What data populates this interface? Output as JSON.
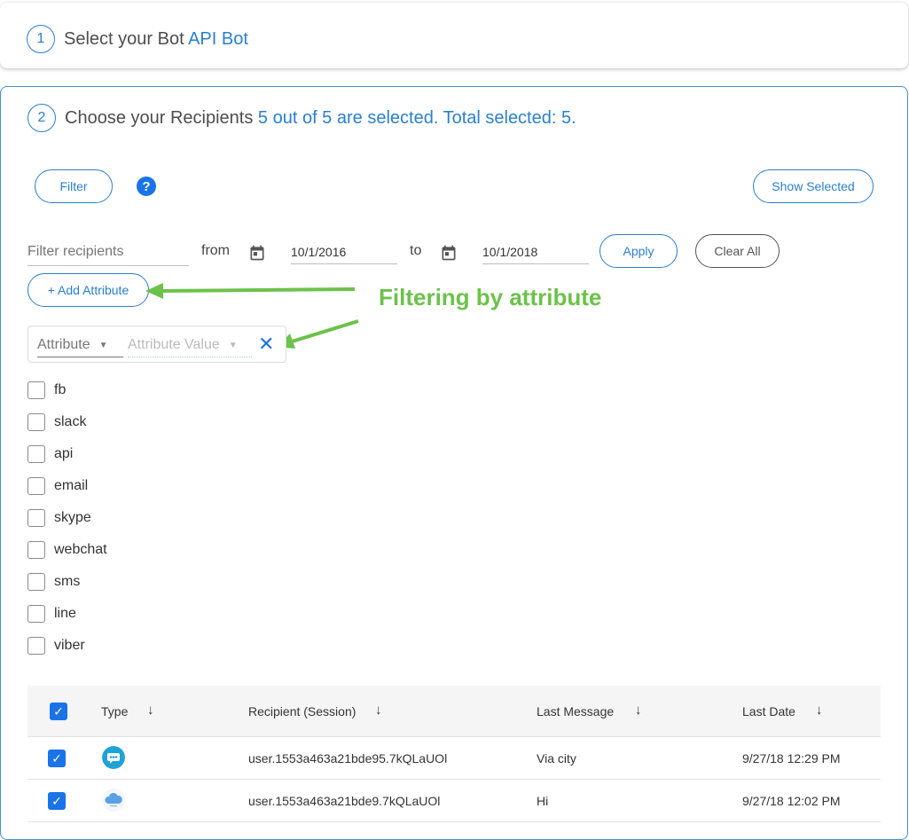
{
  "step1": {
    "number": "1",
    "title": "Select your Bot",
    "bot_name": "API Bot"
  },
  "step2": {
    "number": "2",
    "title": "Choose your Recipients",
    "selection_summary": "5 out of 5 are selected. Total selected: 5."
  },
  "toolbar": {
    "filter_label": "Filter",
    "help_symbol": "?",
    "show_selected_label": "Show Selected"
  },
  "filters": {
    "search_placeholder": "Filter recipients",
    "from_label": "from",
    "from_date": "10/1/2016",
    "to_label": "to",
    "to_date": "10/1/2018",
    "apply_label": "Apply",
    "clear_all_label": "Clear All",
    "add_attribute_label": "+ Add Attribute",
    "attribute_placeholder": "Attribute",
    "attribute_value_placeholder": "Attribute Value"
  },
  "annotation": {
    "text": "Filtering by attribute",
    "color": "#6cc24a"
  },
  "channels": [
    "fb",
    "slack",
    "api",
    "email",
    "skype",
    "webchat",
    "sms",
    "line",
    "viber"
  ],
  "table": {
    "headers": {
      "type": "Type",
      "recipient": "Recipient (Session)",
      "last_message": "Last Message",
      "last_date": "Last Date"
    },
    "sort_icon": "arrow-down-icon",
    "rows": [
      {
        "type_icon": "webchat-icon",
        "recipient": "user.1553a463a21bde95.7kQLaUOl",
        "last_message": "Via city",
        "last_date": "9/27/18 12:29 PM",
        "checked": true
      },
      {
        "type_icon": "cloud-api-icon",
        "recipient": "user.1553a463a21bde9.7kQLaUOl",
        "last_message": "Hi",
        "last_date": "9/27/18 12:02 PM",
        "checked": true
      }
    ]
  },
  "colors": {
    "accent": "#2a7fcf",
    "checkbox": "#1a73e8",
    "annotation": "#6cc24a"
  }
}
